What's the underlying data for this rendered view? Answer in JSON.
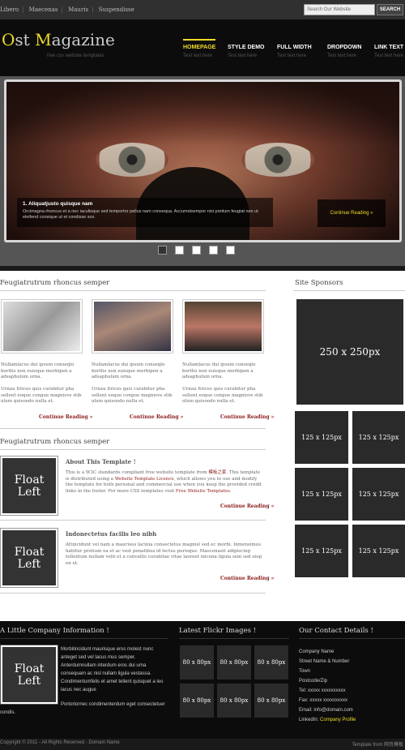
{
  "topbar": {
    "links": [
      "Libero",
      "Maecenas",
      "Mauris",
      "Suspendisse"
    ],
    "search_placeholder": "Search Our Website",
    "search_button": "SEARCH"
  },
  "header": {
    "logo_first": "O",
    "logo_mid1": "st ",
    "logo_m": "M",
    "logo_rest": "agazine",
    "tagline": "free css website templates",
    "nav": [
      {
        "label": "HOMEPAGE",
        "sub": "Test text here"
      },
      {
        "label": "STYLE DEMO",
        "sub": "Test text here"
      },
      {
        "label": "FULL WIDTH",
        "sub": "Test text here"
      },
      {
        "label": "DROPDOWN",
        "sub": "Test text here"
      },
      {
        "label": "LINK TEXT",
        "sub": "Test text here"
      }
    ]
  },
  "slider": {
    "caption_title": "1. Aliquatjusto quisque nam",
    "caption_text": "Orcimagna rhoncus et a nec iaculisque sed temportor pellus nam consequa. Accumstsemper nisi pretium feugiat non ut eleifend consique ut et condisse sce.",
    "button": "Continue Reading »",
    "dots": 5,
    "active_dot": 0
  },
  "main": {
    "section1_title": "Feugiatrutrum rhoncus semper",
    "columns": [
      {
        "p1": "Nullamlacus dui ipsum conseqlo borttis non euisque morbipen a adsaphulum orna.",
        "p2": "Urnau ltrices quis curabitur pha sellent eoque congue magnisve stib ulum quisoodo nulla et.",
        "more": "Continue Reading »"
      },
      {
        "p1": "Nullamlacus dui ipsum conseqlo borttis non euisque morbipen a adsaphulum orna.",
        "p2": "Urnau ltrices quis curabitur pha sellent eoque congue magnisve stib ulum quisoodo nulla et.",
        "more": "Continue Reading »"
      },
      {
        "p1": "Nullamlacus dui ipsum conseqlo borttis non euisque morbipen a adsaphulum orna.",
        "p2": "Urnau ltrices quis curabitur pha sellent eoque congue magnisve stib ulum quisoodo nulla et.",
        "more": "Continue Reading »"
      }
    ],
    "section2_title": "Feugiatrutrum rhoncus semper",
    "posts": [
      {
        "float_line1": "Float",
        "float_line2": "Left",
        "title": "About This Template !",
        "text1": "This is a W3C standards compliant free website template from ",
        "link1": "模板之家",
        "text2": ". This template is distributed using a ",
        "link2": "Website Template Licence",
        "text3": ", which allows you to use and modify the template for both personal and commercial use when you keep the provided credit links in the footer. For more CSS templates visit ",
        "link3": "Free Website Templates",
        "text4": ".",
        "more": "Continue Reading »"
      },
      {
        "float_line1": "Float",
        "float_line2": "Left",
        "title": "Indonectetus facilis leo nibh",
        "text1": "Attincidunt vel nam a maurisus lacinia consectetus magnisl sed ec morbi. Inmensimus habitur pretium ea et ac vest penatibus id lectus purisque. Maecenasit adipiscing tellentum nullam velit et a convallis curabitae vitae laoreet micena ligula sem sed eiep en et.",
        "more": "Continue Reading »"
      }
    ]
  },
  "sidebar": {
    "title": "Site Sponsors",
    "big_ad": "250 x 250px",
    "small_ad": "125 x 125px",
    "small_count": 6
  },
  "footer": {
    "about_title": "A Little Company Information !",
    "about_float1": "Float",
    "about_float2": "Left",
    "about_text": "Morbitincidunt maurisque eros molest nunc anteget sed vel lacus mus semper. Anterdumnullam interdum eros dui urna consequam ac nisl nullam ligula vestassa. Condimentumfelis et amet tellent quisquet a leo lacus nec augue",
    "about_text2": "Portortornec condimenterdum eget consectetuer condis.",
    "flickr_title": "Latest Flickr Images !",
    "flickr_label": "80 x 80px",
    "flickr_count": 6,
    "contact_title": "Our Contact Details !",
    "contact_lines": [
      "Company Name",
      "Street Name & Number",
      "Town",
      "Postcode/Zip",
      "Tel: xxxxx xxxxxxxxxx",
      "Fax: xxxxx xxxxxxxxxx",
      "Email: info@domain.com"
    ],
    "linkedin_label": "LinkedIn: ",
    "linkedin_link": "Company Profile",
    "copyright": "Copyright © 2011 - All Rights Reserved - Domain Name",
    "credit": "Template from 网页模板"
  },
  "colors": {
    "accent": "#f0dc28",
    "link_red": "#8b1a1a",
    "dark": "#0c0c0c"
  }
}
